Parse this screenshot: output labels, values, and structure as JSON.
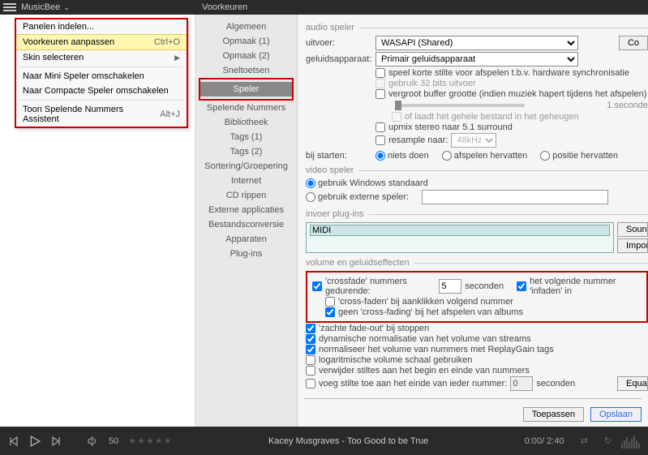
{
  "app_name": "MusicBee",
  "dialog_title": "Voorkeuren",
  "menu": {
    "items": [
      {
        "label": "Panelen indelen...",
        "sc": "",
        "arr": false
      },
      {
        "label": "Voorkeuren aanpassen",
        "sc": "Ctrl+O",
        "arr": false,
        "hi": true
      },
      {
        "label": "Skin selecteren",
        "sc": "",
        "arr": true
      },
      {
        "sep": true
      },
      {
        "label": "Naar Mini Speler omschakelen",
        "sc": "",
        "arr": false
      },
      {
        "label": "Naar Compacte Speler omschakelen",
        "sc": "",
        "arr": false
      },
      {
        "sep": true
      },
      {
        "label": "Toon Spelende Nummers Assistent",
        "sc": "Alt+J",
        "arr": false
      }
    ]
  },
  "cats": [
    "Algemeen",
    "Opmaak (1)",
    "Opmaak (2)",
    "Sneltoetsen",
    "Speler",
    "Spelende Nummers",
    "Bibliotheek",
    "Tags (1)",
    "Tags (2)",
    "Sortering/Groepering",
    "Internet",
    "CD rippen",
    "Externe applicaties",
    "Bestandsconversie",
    "Apparaten",
    "Plug-ins"
  ],
  "audio": {
    "header": "audio speler",
    "uitvoer_lbl": "uitvoer:",
    "uitvoer_val": "WASAPI (Shared)",
    "device_lbl": "geluidsapparaat:",
    "device_val": "Primair geluidsapparaat",
    "silence": "speel korte stilte voor afspelen t.b.v. hardware synchronisatie",
    "bits32": "gebruik 32 bits uitvoer",
    "buffer": "vergroot buffer grootte (indien muziek hapert tijdens het afspelen)",
    "buffer_unit": "1 seconde",
    "loadall": "of laadt het gehele bestand in het geheugen",
    "upmix": "upmix stereo naar 5.1 surround",
    "resample": "resample naar:",
    "resample_val": "48kHz",
    "start_lbl": "bij starten:",
    "start_opts": [
      "niets doen",
      "afspelen hervatten",
      "positie hervatten"
    ],
    "co_btn": "Co"
  },
  "video": {
    "header": "video speler",
    "opt1": "gebruik Windows standaard",
    "opt2": "gebruik externe speler:"
  },
  "plugins": {
    "header": "invoer plug-ins",
    "midi": "MIDI",
    "sound_btn": "Soundf",
    "import_btn": "Impor"
  },
  "vol": {
    "header": "volume en geluidseffecten",
    "cf_lbl1": "'crossfade' nummers gedurende:",
    "cf_val": "5",
    "cf_unit": "seconden",
    "cf_infade": "het volgende nummer 'infaden' in",
    "cf_click": "'cross-faden' bij aanklikken volgend nummer",
    "cf_album": "geen 'cross-fading' bij het afspelen van albums",
    "fadeout": "'zachte fade-out' bij stoppen",
    "dynnorm": "dynamische normalisatie van het volume van streams",
    "replaygain": "normaliseer het volume van nummers met ReplayGain tags",
    "logvol": "logaritmische volume schaal gebruiken",
    "trimsilence": "verwijder stiltes aan het begin en einde van nummers",
    "addsilence": "voeg stilte toe aan het einde van ieder nummer:",
    "addsilence_val": "0",
    "addsilence_unit": "seconden",
    "equa_btn": "Equa"
  },
  "footer": {
    "apply": "Toepassen",
    "save": "Opslaan"
  },
  "player": {
    "vol": "50",
    "track": "Kacey Musgraves - Too Good to be True",
    "time": "0:00/ 2:40"
  }
}
